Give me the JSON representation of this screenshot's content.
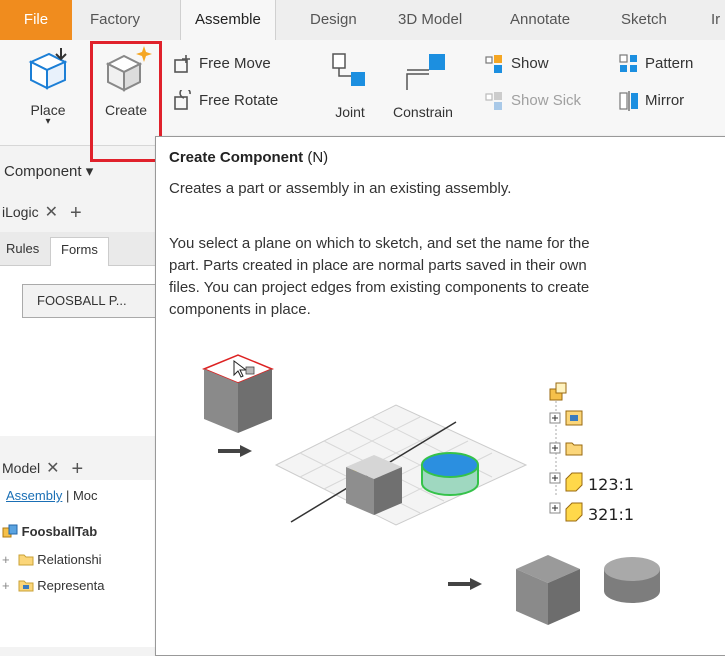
{
  "tabs": [
    "File",
    "Factory",
    "Assemble",
    "Design",
    "3D Model",
    "Annotate",
    "Sketch",
    "Ir"
  ],
  "ribbon": {
    "place": "Place",
    "create": "Create",
    "free_move": "Free Move",
    "free_rotate": "Free Rotate",
    "joint": "Joint",
    "constrain": "Constrain",
    "show": "Show",
    "show_sick": "Show Sick",
    "pattern": "Pattern",
    "mirror": "Mirror",
    "component_group": "Component ▾"
  },
  "ilogic_panel": {
    "title": "iLogic",
    "tabs": [
      "Rules",
      "Forms"
    ],
    "form_button": "FOOSBALL P..."
  },
  "model_panel": {
    "title": "Model",
    "sub_link": "Assembly",
    "sub_other": "| Moc",
    "tree": [
      {
        "label": "FoosballTab",
        "bold": true
      },
      {
        "label": "Relationshi"
      },
      {
        "label": "Representa"
      }
    ]
  },
  "tooltip": {
    "title": "Create Component",
    "shortcut": "(N)",
    "description": "Creates a part or assembly in an existing assembly.",
    "body_lines": [
      "You select a plane on which to sketch, and set the name for the",
      "part. Parts created in place are normal parts saved in their own",
      "files. You can project edges from existing components to create",
      "components in place."
    ],
    "illustration_tree": [
      "123:1",
      "321:1"
    ]
  },
  "colors": {
    "file_tab": "#f08c1e",
    "highlight": "#e0212b",
    "link": "#1a6fb5"
  }
}
